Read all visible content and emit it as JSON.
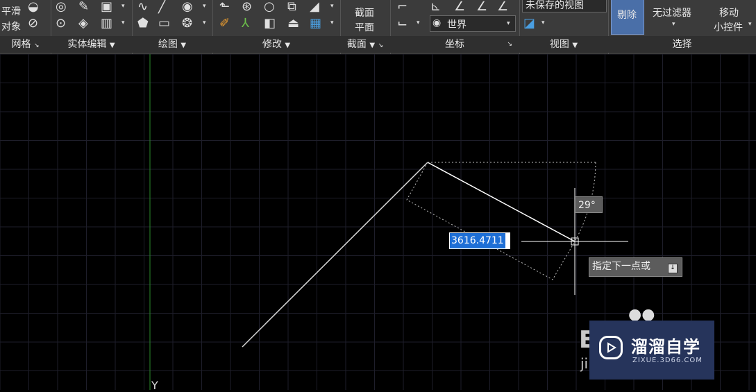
{
  "ribbon": {
    "left_button": {
      "line1": "平滑",
      "line2": "对象"
    },
    "section_plane_button": {
      "line1": "截面",
      "line2": "平面"
    },
    "ucs_dropdown": {
      "value": "世界"
    },
    "view_dropdown": {
      "value": "未保存的视图"
    },
    "remove_button": "剔除",
    "filter_button": "无过滤器",
    "move_gizmo_button": {
      "line1": "移动",
      "line2": "小控件"
    },
    "panels": [
      "网格",
      "实体编辑",
      "绘图",
      "修改",
      "截面",
      "坐标",
      "视图",
      "选择"
    ]
  },
  "canvas": {
    "dynamic_input_value": "3616.4711",
    "angle_readout": "29°",
    "command_prompt": "指定下一点或",
    "y_axis_label": "Y"
  },
  "watermark": {
    "title": "溜溜自学",
    "url": "ZIXUE.3D66.COM",
    "bg_text_1": "E",
    "bg_text_2": "ji"
  },
  "colors": {
    "ribbon_bg": "#3b3b3b",
    "canvas_bg": "#000000",
    "grid": "#1e1e2a",
    "selection": "#1e6fd6",
    "watermark_bg": "#26345b"
  }
}
